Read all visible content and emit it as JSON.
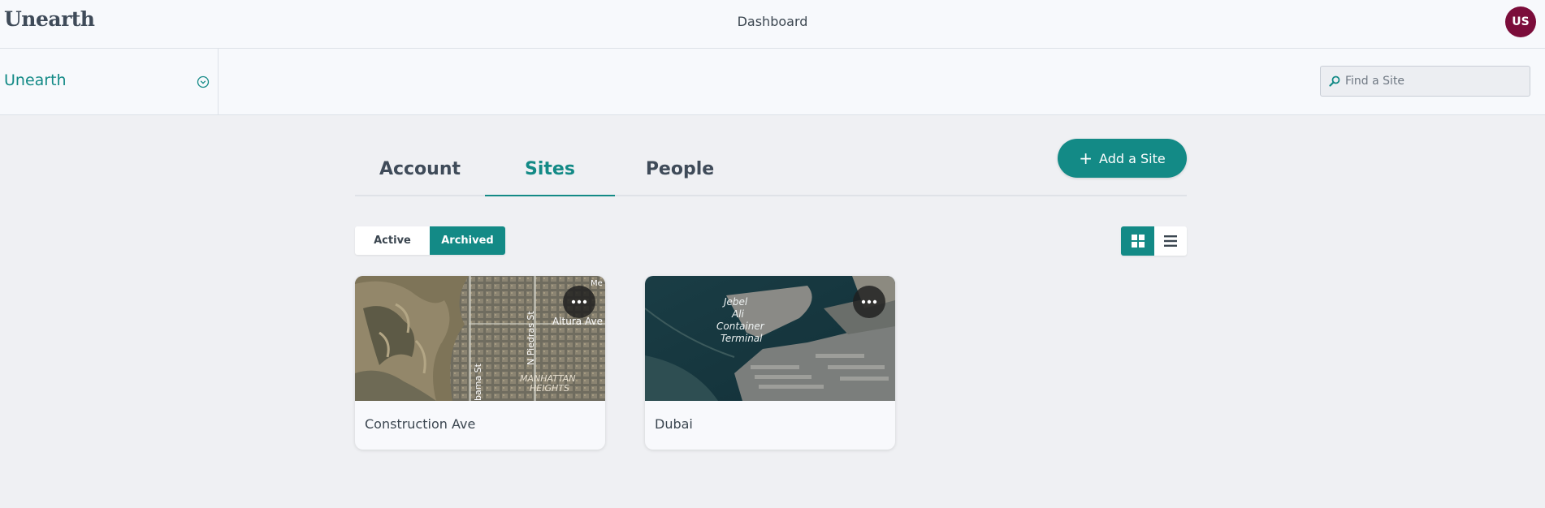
{
  "header": {
    "logo": "Unearth",
    "title": "Dashboard",
    "avatar_initials": "US"
  },
  "org": {
    "name": "Unearth"
  },
  "search": {
    "placeholder": "Find a Site"
  },
  "tabs": [
    {
      "label": "Account"
    },
    {
      "label": "Sites"
    },
    {
      "label": "People"
    }
  ],
  "active_tab": "Sites",
  "add_button": {
    "label": "Add a Site"
  },
  "filter": {
    "options": [
      "Active",
      "Archived"
    ],
    "selected": "Archived"
  },
  "view_mode": "grid",
  "sites": [
    {
      "name": "Construction Ave",
      "map_labels": [
        "Altura Ave",
        "N Piedras St",
        "bama St",
        "MANHATTAN",
        "HEIGHTS",
        "Me"
      ]
    },
    {
      "name": "Dubai",
      "map_labels": [
        "Jebel",
        "Ali",
        "Container",
        "Terminal"
      ]
    }
  ],
  "colors": {
    "accent": "#138a86",
    "avatar": "#7b0d3a",
    "background": "#eff0f3"
  }
}
